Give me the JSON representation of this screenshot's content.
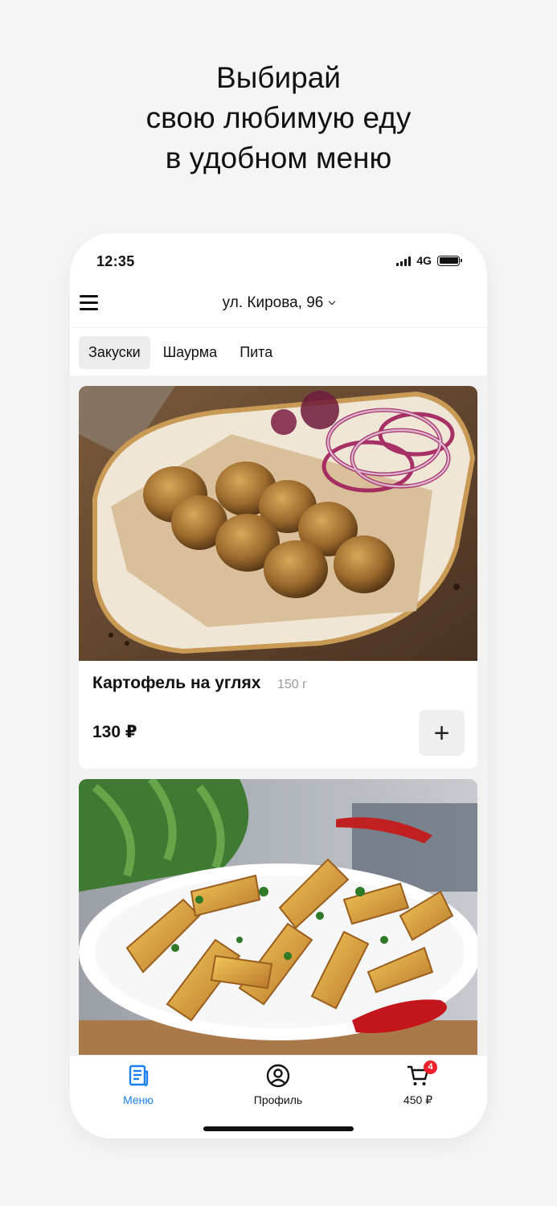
{
  "headline": {
    "line1": "Выбирай",
    "line2": "свою любимую еду",
    "line3": "в удобном меню"
  },
  "status_bar": {
    "time": "12:35",
    "network": "4G"
  },
  "app_bar": {
    "address": "ул. Кирова, 96",
    "menu_icon": "hamburger-icon",
    "dropdown_icon": "chevron-down-icon"
  },
  "tabs": [
    {
      "label": "Закуски",
      "active": true
    },
    {
      "label": "Шаурма",
      "active": false
    },
    {
      "label": "Пита",
      "active": false
    }
  ],
  "products": [
    {
      "title": "Картофель на углях",
      "weight": "150 г",
      "price": "130 ₽",
      "add_icon": "plus-icon"
    },
    {
      "title": "",
      "weight": "",
      "price": ""
    }
  ],
  "bottom_nav": {
    "menu": {
      "label": "Меню",
      "icon": "document-icon",
      "active": true
    },
    "profile": {
      "label": "Профиль",
      "icon": "user-circle-icon"
    },
    "cart": {
      "label": "450 ₽",
      "icon": "cart-icon",
      "badge": "4"
    }
  },
  "colors": {
    "accent": "#1a7ff2",
    "badge": "#f0212b",
    "page_bg": "#f5f5f5"
  }
}
